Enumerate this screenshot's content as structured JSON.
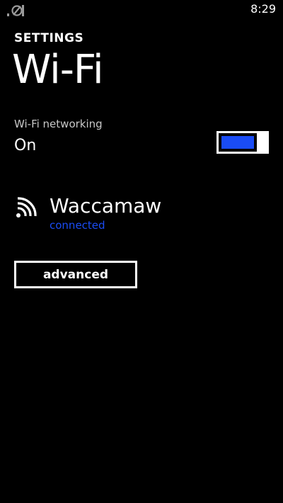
{
  "status_bar": {
    "signal_icon": "signal-strength-icon",
    "time": "8:29"
  },
  "header": {
    "section": "SETTINGS",
    "title": "Wi-Fi"
  },
  "wifi_networking": {
    "label": "Wi-Fi networking",
    "state": "On",
    "enabled": true
  },
  "network": {
    "icon": "wifi-icon",
    "name": "Waccamaw",
    "status": "connected"
  },
  "advanced_button": {
    "label": "advanced"
  },
  "colors": {
    "background": "#000000",
    "text": "#ffffff",
    "accent": "#1a4cf5",
    "secondary_text": "#c8c8c8"
  }
}
